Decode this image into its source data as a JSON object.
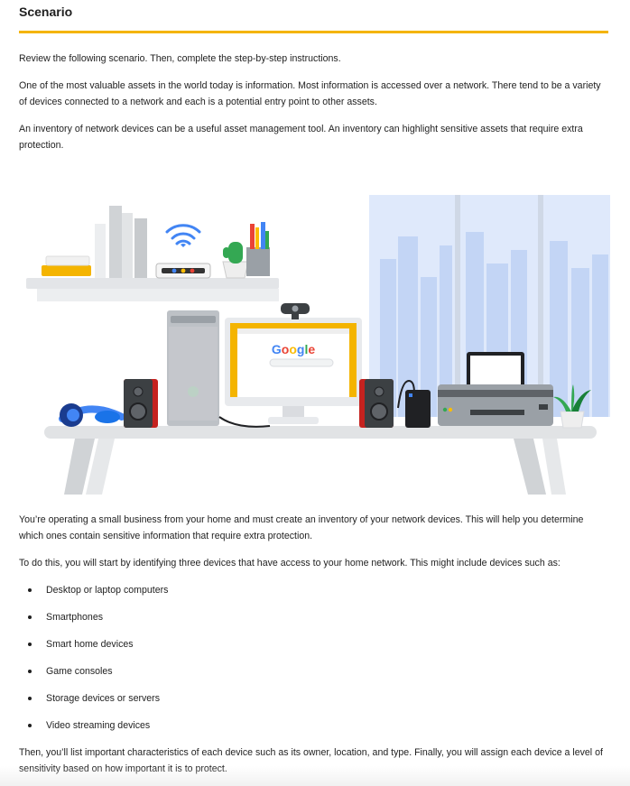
{
  "header": {
    "title": "Scenario"
  },
  "paragraphs": {
    "p1": "Review the following scenario. Then, complete the step-by-step instructions.",
    "p2": "One of the most valuable assets in the world today is information. Most information is accessed over a network. There tend to be a variety of devices connected to a network and each is a potential entry point to other assets.",
    "p3": "An inventory of network devices can be a useful asset management tool. An inventory can highlight sensitive assets that require extra protection.",
    "p4": "You’re operating a small business from your home and must create an inventory of your network devices. This will help you determine which ones contain sensitive information that require extra protection.",
    "p5": "To do this, you will start by identifying three devices that have access to your home network. This might include devices such as:",
    "p6": "Then, you’ll list important characteristics of each device such as its owner, location, and type. Finally, you will assign each device a level of sensitivity based on how important it is to protect."
  },
  "device_examples": [
    "Desktop or laptop computers",
    "Smartphones",
    "Smart home devices",
    "Game consoles",
    "Storage devices or servers",
    "Video streaming devices"
  ],
  "illustration": {
    "monitor_logo": "Google",
    "colors": {
      "accent_yellow": "#f4b400",
      "google_blue": "#4285f4",
      "google_red": "#ea4335",
      "google_green": "#34a853"
    }
  }
}
